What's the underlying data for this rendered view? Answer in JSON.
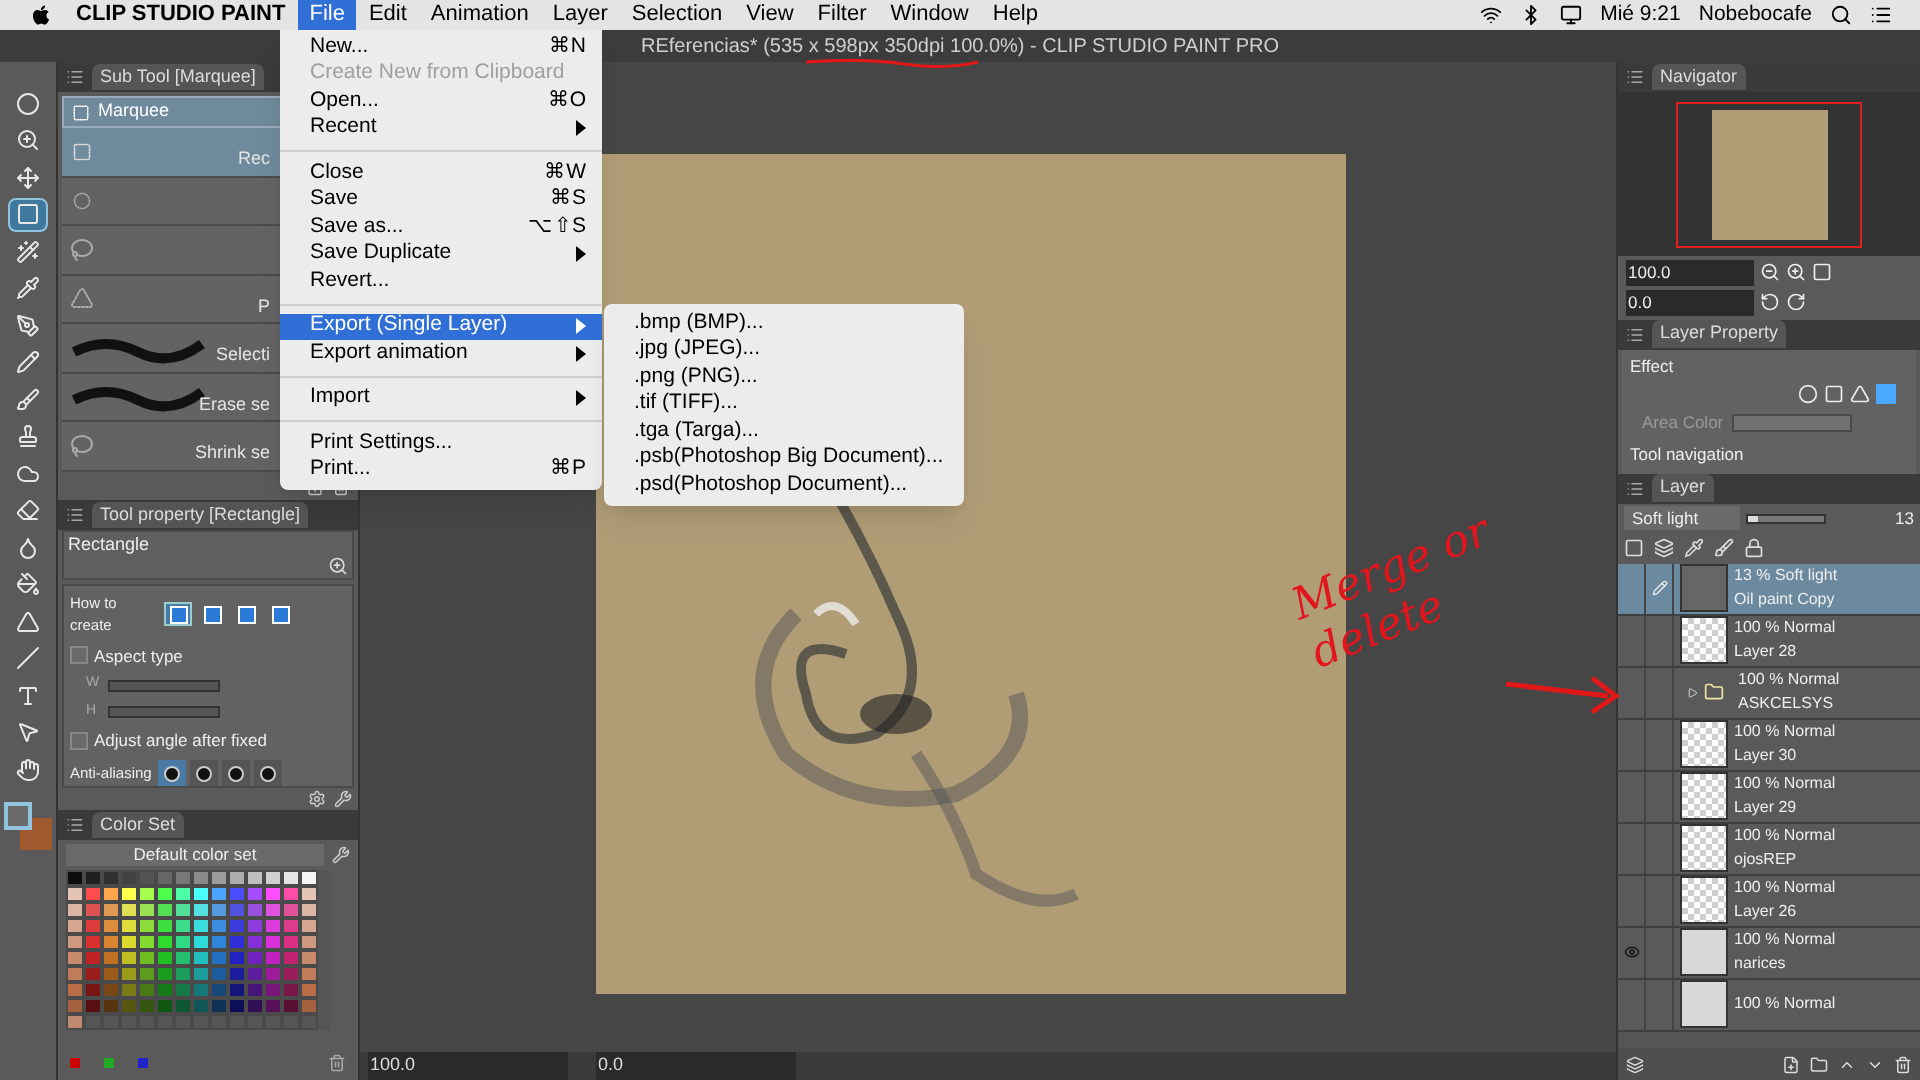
{
  "menu_bar": {
    "app_name": "CLIP STUDIO PAINT",
    "menus": [
      {
        "label": "File",
        "selected": true
      },
      {
        "label": "Edit",
        "selected": false
      },
      {
        "label": "Animation",
        "selected": false
      },
      {
        "label": "Layer",
        "selected": false
      },
      {
        "label": "Selection",
        "selected": false
      },
      {
        "label": "View",
        "selected": false
      },
      {
        "label": "Filter",
        "selected": false
      },
      {
        "label": "Window",
        "selected": false
      },
      {
        "label": "Help",
        "selected": false
      }
    ],
    "clock": "Mié 9:21",
    "user": "Nobebocafe"
  },
  "title_bar": {
    "title": "REferencias* (535 x 598px 350dpi 100.0%)  - CLIP STUDIO PAINT PRO"
  },
  "file_menu": {
    "items": [
      {
        "kind": "item",
        "label": "New...",
        "shortcut": "⌘N",
        "disabled": false,
        "selected": false,
        "submenu": false
      },
      {
        "kind": "item",
        "label": "Create New from Clipboard",
        "disabled": true,
        "selected": false,
        "submenu": false
      },
      {
        "kind": "item",
        "label": "Open...",
        "shortcut": "⌘O",
        "disabled": false,
        "selected": false,
        "submenu": false
      },
      {
        "kind": "item",
        "label": "Recent",
        "disabled": false,
        "selected": false,
        "submenu": true
      },
      {
        "kind": "separator"
      },
      {
        "kind": "item",
        "label": "Close",
        "shortcut": "⌘W",
        "disabled": false,
        "selected": false,
        "submenu": false
      },
      {
        "kind": "item",
        "label": "Save",
        "shortcut": "⌘S",
        "disabled": false,
        "selected": false,
        "submenu": false
      },
      {
        "kind": "item",
        "label": "Save as...",
        "shortcut": "⌥⇧S",
        "disabled": false,
        "selected": false,
        "submenu": false
      },
      {
        "kind": "item",
        "label": "Save Duplicate",
        "disabled": false,
        "selected": false,
        "submenu": true
      },
      {
        "kind": "item",
        "label": "Revert...",
        "disabled": false,
        "selected": false,
        "submenu": false
      },
      {
        "kind": "separator"
      },
      {
        "kind": "item",
        "label": "Export (Single Layer)",
        "disabled": false,
        "selected": true,
        "submenu": true
      },
      {
        "kind": "item",
        "label": "Export animation",
        "disabled": false,
        "selected": false,
        "submenu": true
      },
      {
        "kind": "separator"
      },
      {
        "kind": "item",
        "label": "Import",
        "disabled": false,
        "selected": false,
        "submenu": true
      },
      {
        "kind": "separator"
      },
      {
        "kind": "item",
        "label": "Print Settings...",
        "disabled": false,
        "selected": false,
        "submenu": false
      },
      {
        "kind": "item",
        "label": "Print...",
        "shortcut": "⌘P",
        "disabled": false,
        "selected": false,
        "submenu": false
      }
    ]
  },
  "export_submenu": {
    "items": [
      ".bmp (BMP)...",
      ".jpg (JPEG)...",
      ".png (PNG)...",
      ".tif (TIFF)...",
      ".tga (Targa)...",
      ".psb(Photoshop Big Document)...",
      ".psd(Photoshop Document)..."
    ]
  },
  "toolbar": {
    "tools": [
      {
        "selected": false
      },
      {
        "selected": false
      },
      {
        "selected": false
      },
      {
        "selected": true
      },
      {
        "selected": false
      },
      {
        "selected": false
      },
      {
        "selected": false
      },
      {
        "selected": false
      },
      {
        "selected": false
      },
      {
        "selected": false
      },
      {
        "selected": false
      },
      {
        "selected": false
      },
      {
        "selected": false
      },
      {
        "selected": false
      },
      {
        "selected": false
      },
      {
        "selected": false
      },
      {
        "selected": false
      },
      {
        "selected": false
      },
      {
        "selected": false
      }
    ]
  },
  "sub_tool": {
    "title": "Sub Tool [Marquee]",
    "group": "Marquee",
    "items": [
      {
        "kind": "rect",
        "label": "Rec",
        "selected": true
      },
      {
        "kind": "ellipse",
        "selected": false
      },
      {
        "kind": "lasso",
        "selected": false
      },
      {
        "kind": "polyline",
        "label": "P",
        "selected": false
      },
      {
        "kind": "brush",
        "label": "Selecti",
        "selected": false
      },
      {
        "kind": "brush",
        "label": "Erase se",
        "selected": false
      },
      {
        "kind": "lasso",
        "label": "Shrink se",
        "selected": false
      }
    ]
  },
  "tool_property": {
    "title": "Tool property [Rectangle]",
    "name": "Rectangle",
    "how_to_create": {
      "label": "How to create",
      "options": [
        {
          "selected": true
        },
        {
          "selected": false
        },
        {
          "selected": false
        },
        {
          "selected": false
        }
      ]
    },
    "aspect_type": {
      "label": "Aspect type",
      "checked": false
    },
    "w_label": "W",
    "h_label": "H",
    "adjust_angle": {
      "label": "Adjust angle after fixed",
      "checked": false
    },
    "anti_aliasing": {
      "label": "Anti-aliasing",
      "options": [
        {
          "selected": true
        },
        {
          "selected": false
        },
        {
          "selected": false
        },
        {
          "selected": false
        }
      ]
    }
  },
  "color_set": {
    "tab": "Color Set",
    "set_name": "Default color set"
  },
  "canvas": {
    "zoom": "100.0",
    "rotation": "0.0"
  },
  "navigator": {
    "tab": "Navigator",
    "zoom": "100.0",
    "rotation": "0.0"
  },
  "layer_property": {
    "tab": "Layer Property",
    "effect": "Effect",
    "area_color": {
      "label": "Area Color",
      "disabled": true
    },
    "tool_navigation": "Tool navigation"
  },
  "layer_panel": {
    "tab": "Layer",
    "blend_mode": "Soft light",
    "opacity": "13",
    "opacity_slider": {
      "level": 0.13
    },
    "layers": [
      {
        "kind": "image",
        "mode": "13 % Soft light",
        "name": "Oil paint Copy",
        "selected": true,
        "visible": false,
        "editing": true
      },
      {
        "kind": "layer",
        "mode": "100 % Normal",
        "name": "Layer 28",
        "selected": false,
        "visible": false,
        "editing": false
      },
      {
        "kind": "folder",
        "mode": "100 % Normal",
        "name": "ASKCELSYS",
        "selected": false,
        "visible": false,
        "editing": false
      },
      {
        "kind": "layer",
        "mode": "100 % Normal",
        "name": "Layer 30",
        "selected": false,
        "visible": false,
        "editing": false
      },
      {
        "kind": "layer",
        "mode": "100 % Normal",
        "name": "Layer 29",
        "selected": false,
        "visible": false,
        "editing": false
      },
      {
        "kind": "layer",
        "mode": "100 % Normal",
        "name": "ojosREP",
        "selected": false,
        "visible": false,
        "editing": false
      },
      {
        "kind": "layer",
        "mode": "100 % Normal",
        "name": "Layer 26",
        "selected": false,
        "visible": false,
        "editing": false
      },
      {
        "kind": "sketch",
        "mode": "100 % Normal",
        "name": "narices",
        "selected": false,
        "visible": true,
        "editing": false
      },
      {
        "kind": "sketch",
        "mode": "100 % Normal",
        "selected": false,
        "visible": false,
        "editing": false
      }
    ]
  },
  "annotation": {
    "note": "Merge or delete"
  }
}
